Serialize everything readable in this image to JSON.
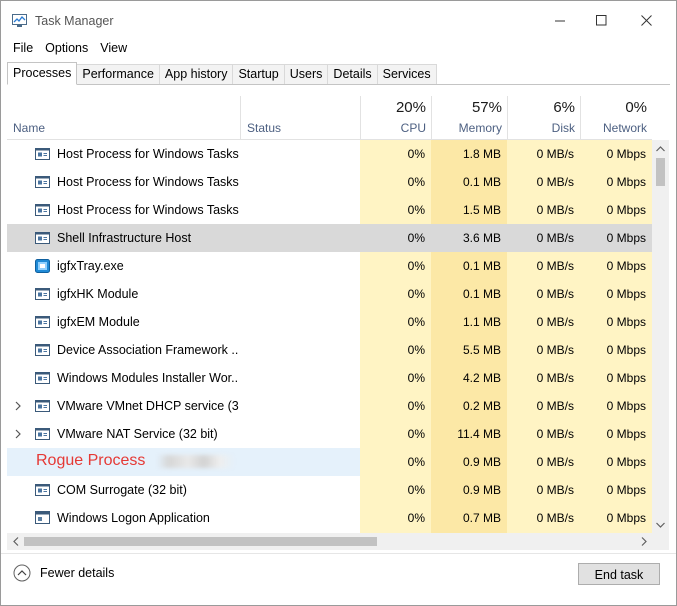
{
  "window": {
    "title": "Task Manager"
  },
  "menu": [
    "File",
    "Options",
    "View"
  ],
  "tabs": [
    "Processes",
    "Performance",
    "App history",
    "Startup",
    "Users",
    "Details",
    "Services"
  ],
  "header": {
    "name": "Name",
    "status": "Status",
    "cpu": {
      "percent": "20%",
      "label": "CPU"
    },
    "memory": {
      "percent": "57%",
      "label": "Memory"
    },
    "disk": {
      "percent": "6%",
      "label": "Disk"
    },
    "network": {
      "percent": "0%",
      "label": "Network"
    }
  },
  "colors": {
    "cpu_bg": "#fff4c4",
    "mem_bg": "#fce8a6",
    "other_bg": "#fff4c4",
    "selected": "#d9d9d9",
    "highlight": "#e5f1fb",
    "rogue": "#e53935"
  },
  "rows": [
    {
      "name": "Host Process for Windows Tasks",
      "icon": "process-icon",
      "expand": false,
      "cpu": "0%",
      "memory": "1.8 MB",
      "disk": "0 MB/s",
      "network": "0 Mbps"
    },
    {
      "name": "Host Process for Windows Tasks",
      "icon": "process-icon",
      "expand": false,
      "cpu": "0%",
      "memory": "0.1 MB",
      "disk": "0 MB/s",
      "network": "0 Mbps"
    },
    {
      "name": "Host Process for Windows Tasks",
      "icon": "process-icon",
      "expand": false,
      "cpu": "0%",
      "memory": "1.5 MB",
      "disk": "0 MB/s",
      "network": "0 Mbps"
    },
    {
      "name": "Shell Infrastructure Host",
      "icon": "process-icon",
      "expand": false,
      "selected": true,
      "cpu": "0%",
      "memory": "3.6 MB",
      "disk": "0 MB/s",
      "network": "0 Mbps"
    },
    {
      "name": "igfxTray.exe",
      "icon": "intel-graphics-icon",
      "expand": false,
      "cpu": "0%",
      "memory": "0.1 MB",
      "disk": "0 MB/s",
      "network": "0 Mbps"
    },
    {
      "name": "igfxHK Module",
      "icon": "process-icon",
      "expand": false,
      "cpu": "0%",
      "memory": "0.1 MB",
      "disk": "0 MB/s",
      "network": "0 Mbps"
    },
    {
      "name": "igfxEM Module",
      "icon": "process-icon",
      "expand": false,
      "cpu": "0%",
      "memory": "1.1 MB",
      "disk": "0 MB/s",
      "network": "0 Mbps"
    },
    {
      "name": "Device Association Framework ...",
      "icon": "process-icon",
      "expand": false,
      "cpu": "0%",
      "memory": "5.5 MB",
      "disk": "0 MB/s",
      "network": "0 Mbps"
    },
    {
      "name": "Windows Modules Installer Wor...",
      "icon": "process-icon",
      "expand": false,
      "cpu": "0%",
      "memory": "4.2 MB",
      "disk": "0 MB/s",
      "network": "0 Mbps"
    },
    {
      "name": "VMware VMnet DHCP service (3...",
      "icon": "process-icon",
      "expand": true,
      "cpu": "0%",
      "memory": "0.2 MB",
      "disk": "0 MB/s",
      "network": "0 Mbps"
    },
    {
      "name": "VMware NAT Service (32 bit)",
      "icon": "process-icon",
      "expand": true,
      "cpu": "0%",
      "memory": "11.4 MB",
      "disk": "0 MB/s",
      "network": "0 Mbps"
    },
    {
      "name": "Rogue Process",
      "icon": "",
      "expand": false,
      "rogue": true,
      "cpu": "0%",
      "memory": "0.9 MB",
      "disk": "0 MB/s",
      "network": "0 Mbps"
    },
    {
      "name": "COM Surrogate (32 bit)",
      "icon": "process-icon",
      "expand": false,
      "cpu": "0%",
      "memory": "0.9 MB",
      "disk": "0 MB/s",
      "network": "0 Mbps"
    },
    {
      "name": "Windows Logon Application",
      "icon": "window-app-icon",
      "expand": false,
      "cpu": "0%",
      "memory": "0.7 MB",
      "disk": "0 MB/s",
      "network": "0 Mbps"
    }
  ],
  "footer": {
    "fewer_details": "Fewer details",
    "end_task": "End task"
  }
}
